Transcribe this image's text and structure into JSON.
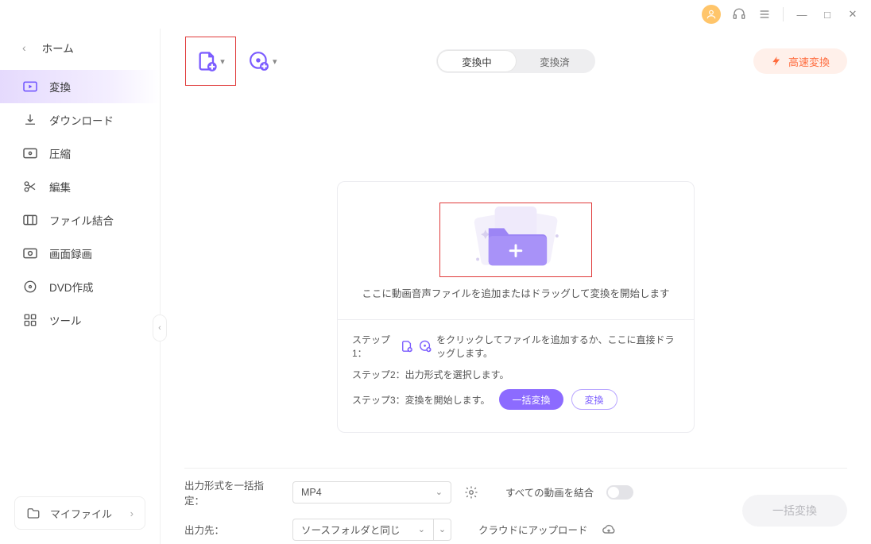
{
  "titlebar": {
    "minimize": "—",
    "maximize": "□",
    "close": "✕"
  },
  "home": {
    "label": "ホーム"
  },
  "nav": {
    "items": [
      {
        "label": "変換"
      },
      {
        "label": "ダウンロード"
      },
      {
        "label": "圧縮"
      },
      {
        "label": "編集"
      },
      {
        "label": "ファイル結合"
      },
      {
        "label": "画面録画"
      },
      {
        "label": "DVD作成"
      },
      {
        "label": "ツール"
      }
    ]
  },
  "myfiles": {
    "label": "マイファイル"
  },
  "tabs": {
    "active": "変換中",
    "inactive": "変換済"
  },
  "fast": {
    "label": "高速変換"
  },
  "dropzone": {
    "text": "ここに動画音声ファイルを追加またはドラッグして変換を開始します"
  },
  "steps": {
    "s1_pre": "ステップ1：",
    "s1_post": "をクリックしてファイルを追加するか、ここに直接ドラッグします。",
    "s2": "ステップ2：出力形式を選択します。",
    "s3": "ステップ3：変換を開始します。",
    "batch_btn": "一括変換",
    "convert_btn": "変換"
  },
  "footer": {
    "format_label": "出力形式を一括指定：",
    "format_value": "MP4",
    "merge_label": "すべての動画を結合",
    "dest_label": "出力先：",
    "dest_value": "ソースフォルダと同じ",
    "cloud_label": "クラウドにアップロード"
  },
  "big_button": "一括変換"
}
